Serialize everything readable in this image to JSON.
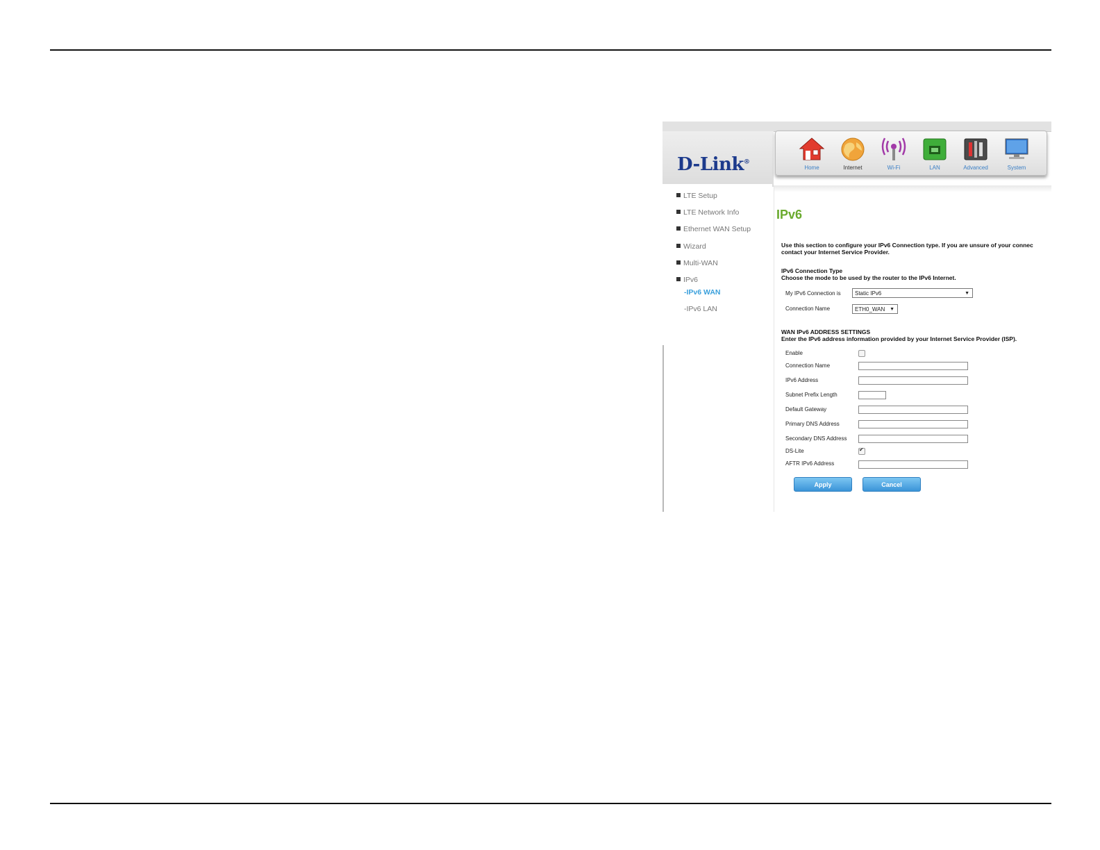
{
  "brand": {
    "logo_text": "D-Link"
  },
  "nav": [
    {
      "label": "Home",
      "icon": "home-icon"
    },
    {
      "label": "Internet",
      "icon": "globe-icon"
    },
    {
      "label": "Wi-Fi",
      "icon": "wifi-icon"
    },
    {
      "label": "LAN",
      "icon": "lan-icon"
    },
    {
      "label": "Advanced",
      "icon": "tools-icon"
    },
    {
      "label": "System",
      "icon": "monitor-icon"
    }
  ],
  "sidebar": {
    "items": [
      {
        "label": "LTE Setup"
      },
      {
        "label": "LTE Network Info"
      },
      {
        "label": "Ethernet WAN Setup"
      },
      {
        "label": "Wizard"
      },
      {
        "label": "Multi-WAN"
      },
      {
        "label": "IPv6"
      }
    ],
    "subitems": [
      {
        "label": "-IPv6 WAN"
      },
      {
        "label": "-IPv6 LAN"
      }
    ]
  },
  "main": {
    "title": "IPv6",
    "intro_line1": "Use this section to configure your IPv6 Connection type. If you are unsure of your connec",
    "intro_line2": "contact your Internet Service Provider.",
    "conn_type_heading": "IPv6 Connection Type",
    "conn_type_desc": "Choose the mode to be used by the router to the IPv6 Internet.",
    "my_conn_label": "My IPv6 Connection is",
    "my_conn_value": "Static IPv6",
    "conn_name_label": "Connection Name",
    "conn_name_value": "ETH0_WAN",
    "wan_heading": "WAN IPv6 ADDRESS SETTINGS",
    "wan_desc": "Enter the IPv6 address information provided by your Internet Service Provider (ISP).",
    "fields": {
      "enable": "Enable",
      "connection_name": "Connection Name",
      "ipv6_address": "IPv6 Address",
      "subnet_prefix": "Subnet Prefix Length",
      "default_gateway": "Default Gateway",
      "primary_dns": "Primary DNS Address",
      "secondary_dns": "Secondary DNS Address",
      "ds_lite": "DS-Lite",
      "aftr": "AFTR IPv6 Address"
    },
    "apply_label": "Apply",
    "cancel_label": "Cancel"
  }
}
